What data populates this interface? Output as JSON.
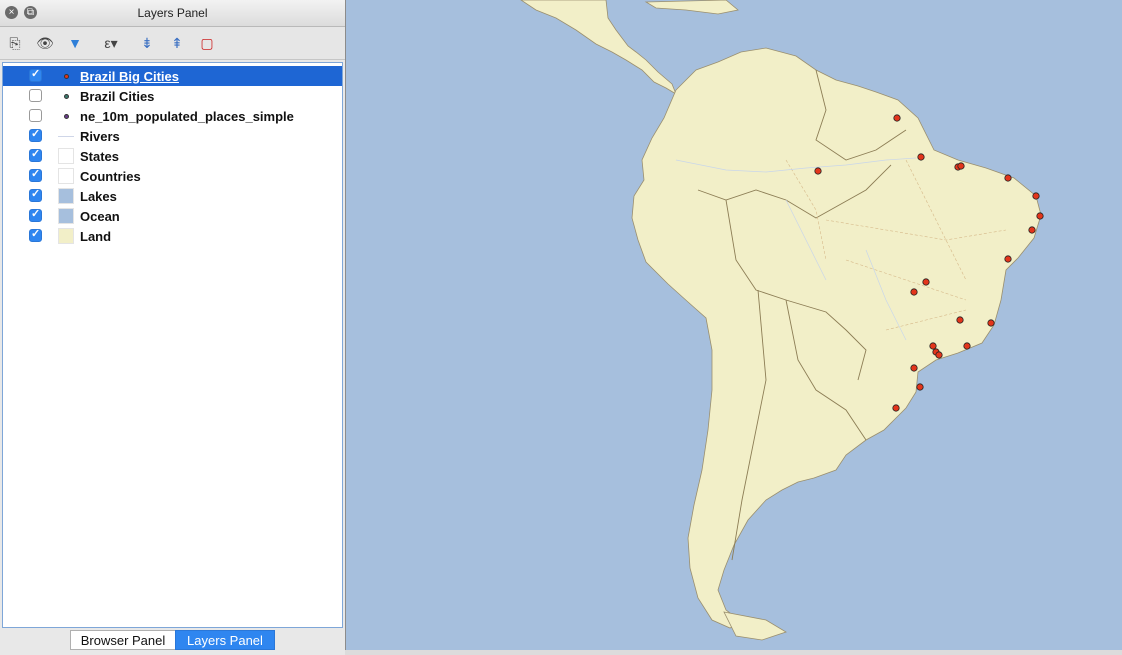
{
  "window": {
    "title": "Layers Panel"
  },
  "layers": [
    {
      "label": "Brazil Big Cities",
      "checked": true,
      "selected": true,
      "symbol": "dot",
      "color": "#e3351b"
    },
    {
      "label": "Brazil Cities",
      "checked": false,
      "selected": false,
      "symbol": "dot",
      "color": "#3c7a6e"
    },
    {
      "label": "ne_10m_populated_places_simple",
      "checked": false,
      "selected": false,
      "symbol": "dot",
      "color": "#6a3e8a"
    },
    {
      "label": "Rivers",
      "checked": true,
      "selected": false,
      "symbol": "line",
      "color": "#cfd6e8"
    },
    {
      "label": "States",
      "checked": true,
      "selected": false,
      "symbol": "fill",
      "color": "#ffffff"
    },
    {
      "label": "Countries",
      "checked": true,
      "selected": false,
      "symbol": "fill",
      "color": "#ffffff"
    },
    {
      "label": "Lakes",
      "checked": true,
      "selected": false,
      "symbol": "fill",
      "color": "#a6bfdd"
    },
    {
      "label": "Ocean",
      "checked": true,
      "selected": false,
      "symbol": "fill",
      "color": "#a6bfdd"
    },
    {
      "label": "Land",
      "checked": true,
      "selected": false,
      "symbol": "fill",
      "color": "#f2efc8"
    }
  ],
  "tabs": [
    {
      "label": "Browser Panel",
      "active": false
    },
    {
      "label": "Layers Panel",
      "active": true
    }
  ],
  "colors": {
    "ocean": "#a6bfdd",
    "land": "#f2efc8",
    "selection": "#1e66d4",
    "city": "#e3351b"
  },
  "icons": [
    "close-icon",
    "float-icon",
    "add-group-icon",
    "visibility-icon",
    "filter-icon",
    "expression-filter-icon",
    "expand-all-icon",
    "collapse-all-icon",
    "remove-layer-icon"
  ]
}
